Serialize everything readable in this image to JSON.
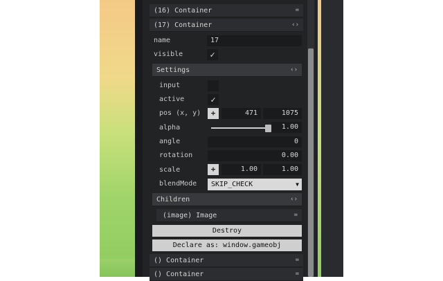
{
  "tree": {
    "container16_label": "(16) Container",
    "container17_label": "(17) Container",
    "container_a_label": "() Container",
    "container_b_label": "() Container",
    "closed_ctl": "=",
    "open_ctl": "‹›"
  },
  "props": {
    "name_label": "name",
    "name_value": "17",
    "visible_label": "visible",
    "visible_checked": true
  },
  "settings": {
    "title": "Settings",
    "input_label": "input",
    "input_checked": false,
    "active_label": "active",
    "active_checked": true,
    "pos_label": "pos (x, y)",
    "pos_x": "471",
    "pos_y": "1075",
    "alpha_label": "alpha",
    "alpha_value": "1.00",
    "alpha_fraction": 1.0,
    "angle_label": "angle",
    "angle_value": "0",
    "rotation_label": "rotation",
    "rotation_value": "0.00",
    "scale_label": "scale",
    "scale_x": "1.00",
    "scale_y": "1.00",
    "blend_label": "blendMode",
    "blend_value": "SKIP_CHECK"
  },
  "children": {
    "title": "Children",
    "image_label": "(image) Image"
  },
  "actions": {
    "destroy": "Destroy",
    "declare": "Declare as: window.gameobj"
  },
  "icons": {
    "check": "check-icon",
    "move": "crosshair-move-icon",
    "dropdown": "chevron-down-icon"
  }
}
